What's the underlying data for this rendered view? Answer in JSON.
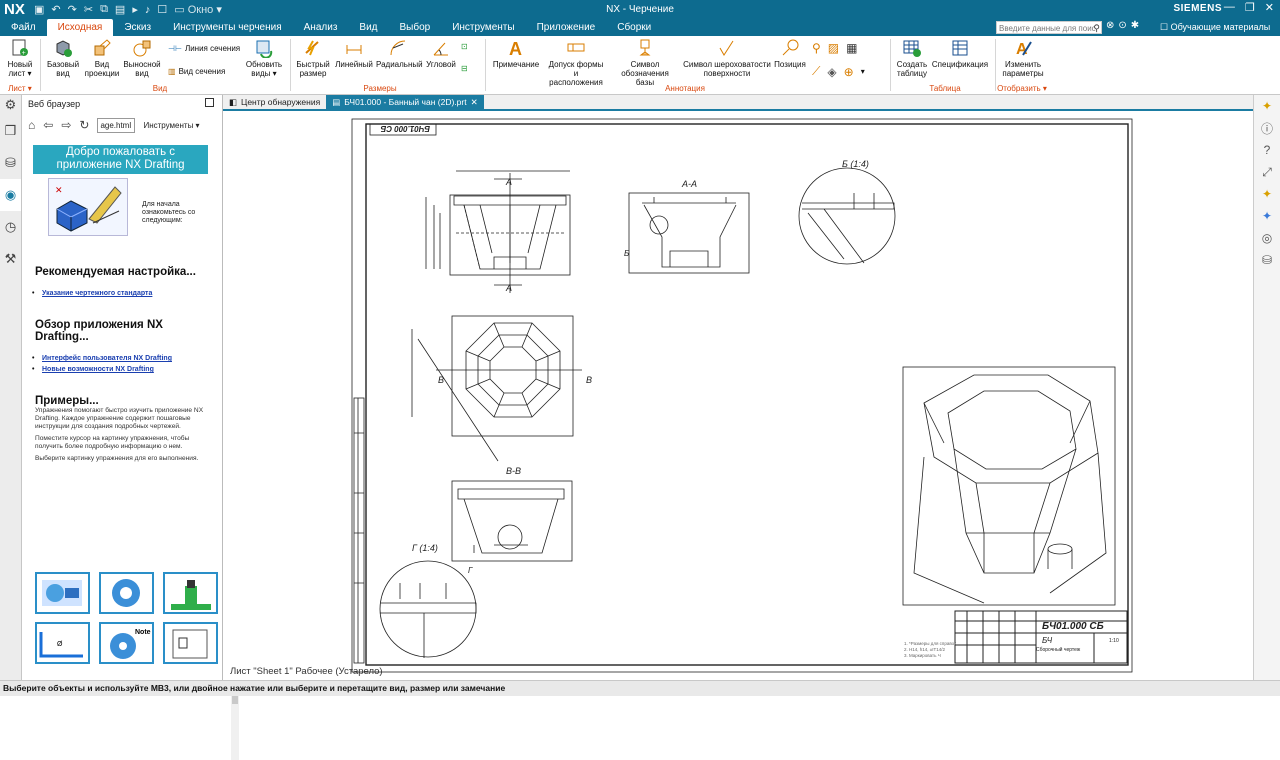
{
  "app": {
    "logo": "NX",
    "window_title": "NX - Черчение",
    "brand": "SIEMENS",
    "window_menu": "Окно",
    "search_placeholder": "Введите данные для поис",
    "learning": "Обучающие материалы"
  },
  "menu": [
    "Файл",
    "Исходная",
    "Эскиз",
    "Инструменты черчения",
    "Анализ",
    "Вид",
    "Выбор",
    "Инструменты",
    "Приложение",
    "Сборки"
  ],
  "ribbon": {
    "new_sheet": "Новый лист",
    "base_view": "Базовый вид",
    "projected_view": "Вид проекции",
    "detail_view": "Выносной вид",
    "section_line": "Линия сечения",
    "section_view": "Вид сечения",
    "update_views": "Обновить виды",
    "quick_dim": "Быстрый размер",
    "linear": "Линейный",
    "radial": "Радиальный",
    "angular": "Угловой",
    "note": "Примечание",
    "fcf": "Допуск формы и расположения",
    "datum": "Символ обозначения базы",
    "roughness": "Символ шероховатости поверхности",
    "balloon": "Позиция",
    "create_table": "Создать таблицу",
    "parts_list": "Спецификация",
    "edit_settings": "Изменить параметры",
    "g_sheet": "Лист",
    "g_view": "Вид",
    "g_dims": "Размеры",
    "g_annot": "Аннотация",
    "g_table": "Таблица",
    "g_display": "Отобразить"
  },
  "browser": {
    "title": "Веб браузер",
    "url": "age.html",
    "tools": "Инструменты",
    "welcome": "Добро пожаловать с приложение NX Drafting",
    "intro": "Для начала ознакомьтесь со следующим:",
    "h_setup": "Рекомендуемая настройка...",
    "l_standard": "Указание чертежного стандарта",
    "h_overview": "Обзор приложения NX Drafting...",
    "l_ui": "Интерфейс пользователя NX Drafting",
    "l_new": "Новые возможности NX Drafting",
    "h_examples": "Примеры...",
    "p1": "Упражнения помогают быстро изучить приложение NX Drafting. Каждое упражнение содержит пошаговые инструкции для создания подробных чертежей.",
    "p2": "Поместите курсор на картинку упражнения, чтобы получить более подробную информацию о нем.",
    "p3": "Выберите картинку упражнения для его выполнения.",
    "thumb_note": "Note"
  },
  "tabs": [
    "Центр обнаружения",
    "БЧ01.000 - Банный чан (2D).prt"
  ],
  "drawing": {
    "stamp_code": "БЧ01.000 СБ",
    "stamp_mirrored": "БЧ01.000 СБ",
    "stamp_name": "БЧ",
    "stamp_sub": "Сборочный чертеж",
    "scale": "1:10",
    "label_A": "А",
    "label_AA": "А-А",
    "label_B": "Б (1:4)",
    "label_BB": "В-В",
    "label_V": "В",
    "label_G": "Г (1:4)",
    "label_Bsmall": "Б",
    "label_Gsmall": "Г",
    "notes": [
      "1. *Размеры для справок",
      "2. H14, h14, ±IT14/2",
      "3. Маркировать Ч"
    ]
  },
  "sheet_status": "Лист \"Sheet 1\" Рабочее (Устарело)",
  "status_bar": "Выберите объекты и используйте МВ3, или двойное нажатие или выберите и перетащите вид, размер или замечание"
}
